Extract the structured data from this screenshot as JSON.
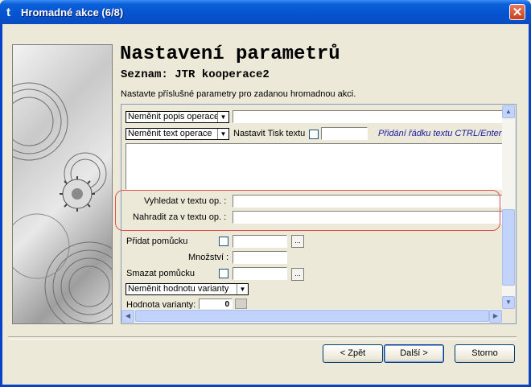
{
  "window": {
    "title": "Hromadné akce (6/8)",
    "app_icon": "t",
    "close_glyph": "✕"
  },
  "header": {
    "title": "Nastavení parametrů",
    "subtitle": "Seznam: JTR kooperace2",
    "instruction": "Nastavte příslušné parametry pro zadanou hromadnou akci."
  },
  "params": {
    "op_desc_combo": "Neměnit popis operace",
    "op_text_combo": "Neměnit text operace",
    "print_text_label": "Nastavit Tisk textu",
    "add_line_hint": "Přidání řádku textu CTRL/Enter",
    "search_label": "Vyhledat v textu op. :",
    "replace_label": "Nahradit za v textu op. :",
    "add_tool_label": "Přidat pomůcku",
    "quantity_label": "Množství :",
    "remove_tool_label": "Smazat pomůcku",
    "variant_combo": "Neměnit hodnotu varianty",
    "variant_value_label": "Hodnota varianty:",
    "variant_value": "0",
    "ellipsis": "..."
  },
  "buttons": {
    "back": "< Zpět",
    "next": "Další >",
    "cancel": "Storno"
  },
  "colors": {
    "titlebar": "#0653d0",
    "hint_text": "#1a1aa6",
    "highlight": "#e05050"
  }
}
